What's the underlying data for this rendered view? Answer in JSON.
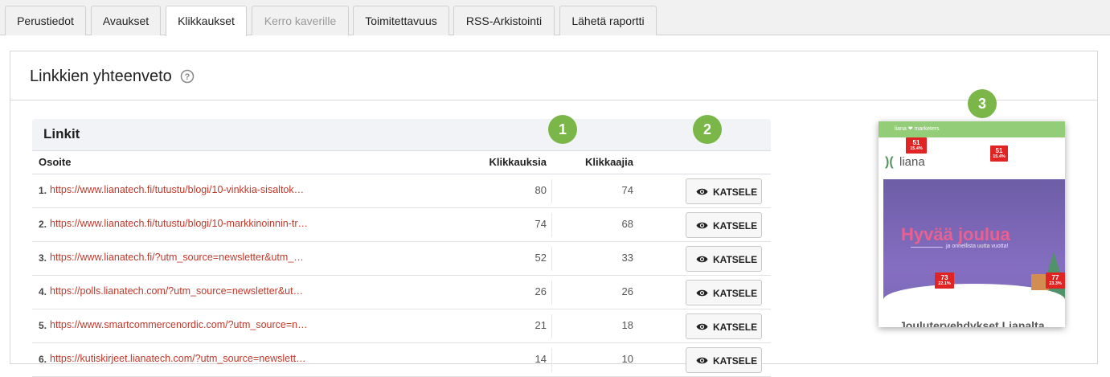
{
  "tabs": [
    {
      "label": "Perustiedot"
    },
    {
      "label": "Avaukset"
    },
    {
      "label": "Klikkaukset"
    },
    {
      "label": "Kerro kaverille"
    },
    {
      "label": "Toimitettavuus"
    },
    {
      "label": "RSS-Arkistointi"
    },
    {
      "label": "Lähetä raportti"
    }
  ],
  "panel": {
    "title": "Linkkien yhteenveto",
    "help_icon": "question-circle-icon"
  },
  "links": {
    "title": "Linkit",
    "columns": {
      "address": "Osoite",
      "clicks": "Klikkauksia",
      "clickers": "Klikkaajia"
    },
    "rows": [
      {
        "num": "1.",
        "url": "https://www.lianatech.fi/tutustu/blogi/10-vinkkia-sisaltok…",
        "clicks": "80",
        "clickers": "74",
        "action": "KATSELE"
      },
      {
        "num": "2.",
        "url": "https://www.lianatech.fi/tutustu/blogi/10-markkinoinnin-tr…",
        "clicks": "74",
        "clickers": "68",
        "action": "KATSELE"
      },
      {
        "num": "3.",
        "url": "https://www.lianatech.fi/?utm_source=newsletter&utm_…",
        "clicks": "52",
        "clickers": "33",
        "action": "KATSELE"
      },
      {
        "num": "4.",
        "url": "https://polls.lianatech.com/?utm_source=newsletter&ut…",
        "clicks": "26",
        "clickers": "26",
        "action": "KATSELE"
      },
      {
        "num": "5.",
        "url": "https://www.smartcommercenordic.com/?utm_source=n…",
        "clicks": "21",
        "clickers": "18",
        "action": "KATSELE"
      },
      {
        "num": "6.",
        "url": "https://kutiskirjeet.lianatech.com/?utm_source=newslett…",
        "clicks": "14",
        "clickers": "10",
        "action": "KATSELE"
      }
    ],
    "view_icon": "eye-icon"
  },
  "badges": [
    "1",
    "2",
    "3"
  ],
  "preview": {
    "topbar": "liana ❤ marketers",
    "logo": "liana",
    "hero_title": "Hyvää joulua",
    "hero_sub": "ja onnellista uutta vuotta!",
    "bottom_text": "Joulutervehdykset Lianalta",
    "hotspots": [
      {
        "n": "51",
        "p": "15.4%"
      },
      {
        "n": "51",
        "p": "15.4%"
      },
      {
        "n": "73",
        "p": "22.1%"
      },
      {
        "n": "77",
        "p": "23.3%"
      }
    ]
  },
  "colors": {
    "link": "#c0392b",
    "badge": "#7ab648",
    "hotspot": "#e02424"
  }
}
